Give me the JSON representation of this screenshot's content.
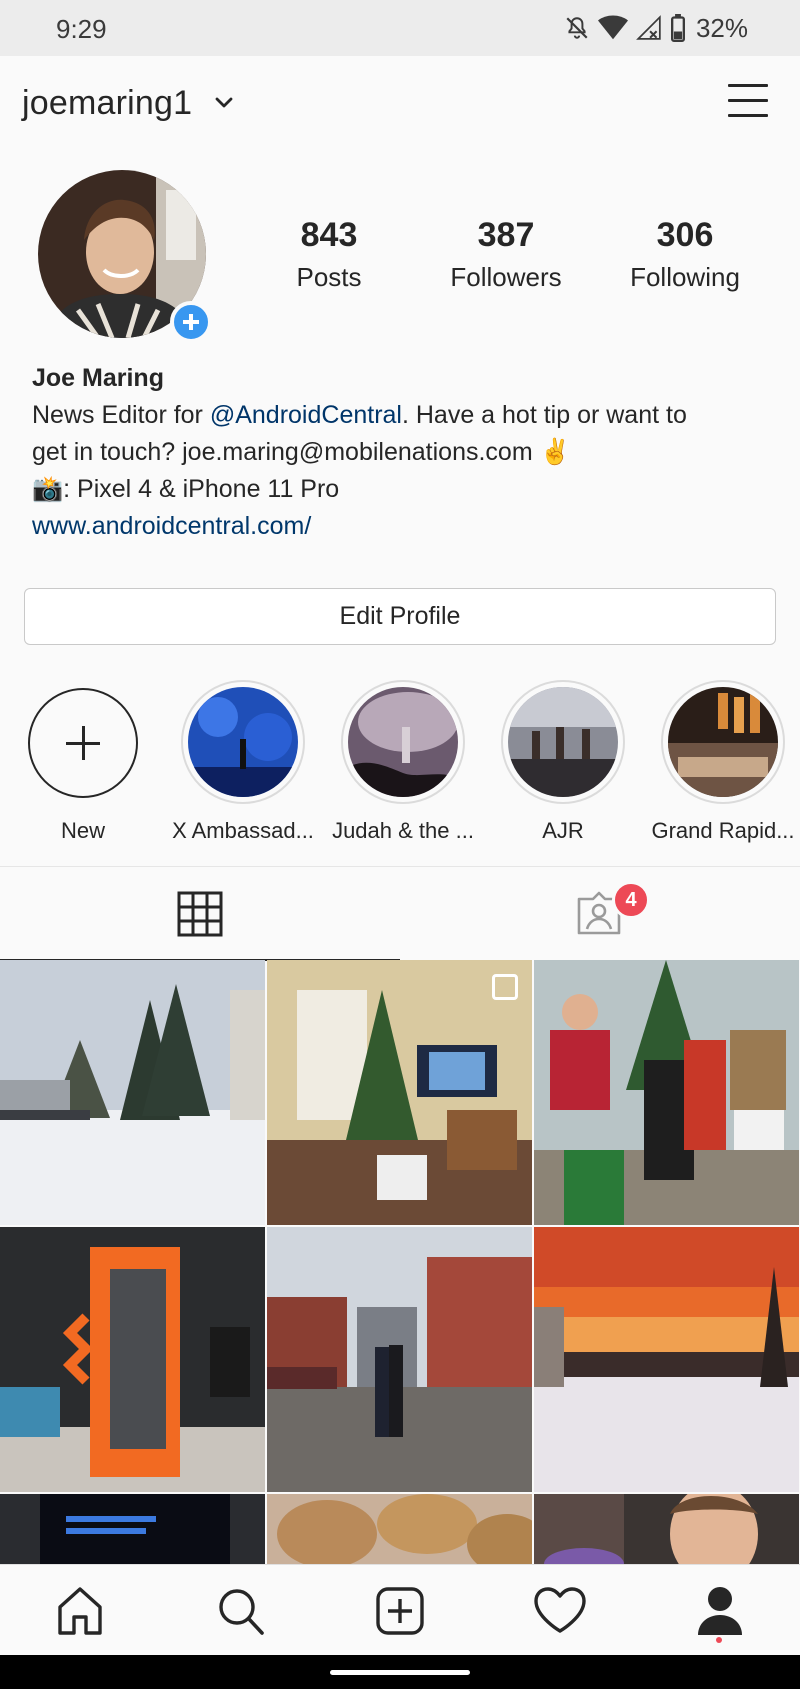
{
  "status_bar": {
    "time": "9:29",
    "battery": "32%",
    "icons": [
      "mute-notifications-icon",
      "wifi-icon",
      "signal-icon",
      "battery-icon"
    ]
  },
  "header": {
    "username": "joemaring1",
    "icons": [
      "chevron-down-icon",
      "hamburger-menu-icon"
    ]
  },
  "profile": {
    "stats": [
      {
        "value": "843",
        "label": "Posts"
      },
      {
        "value": "387",
        "label": "Followers"
      },
      {
        "value": "306",
        "label": "Following"
      }
    ],
    "name": "Joe Maring",
    "bio": {
      "line1_prefix": "News Editor for ",
      "line1_mention": "@AndroidCentral",
      "line1_suffix": ". Have a hot tip or want to",
      "line2": "get in touch? joe.maring@mobilenations.com ✌️",
      "line3": "📸: Pixel 4 & iPhone 11 Pro"
    },
    "website": "www.androidcentral.com/",
    "edit_button": "Edit Profile"
  },
  "highlights": [
    {
      "label": "New",
      "kind": "new"
    },
    {
      "label": "X Ambassad...",
      "kind": "photo"
    },
    {
      "label": "Judah & the ...",
      "kind": "photo"
    },
    {
      "label": "AJR",
      "kind": "photo"
    },
    {
      "label": "Grand Rapid...",
      "kind": "photo"
    }
  ],
  "tabs": {
    "grid_icon": "grid-icon",
    "tagged_icon": "tagged-person-icon",
    "tagged_badge": "4"
  },
  "bottom_nav": [
    "home-icon",
    "search-icon",
    "new-post-icon",
    "activity-heart-icon",
    "profile-icon"
  ],
  "colors": {
    "accent_blue": "#3897f0",
    "badge_red": "#ed4956",
    "link_blue": "#00376b",
    "text": "#262626"
  }
}
